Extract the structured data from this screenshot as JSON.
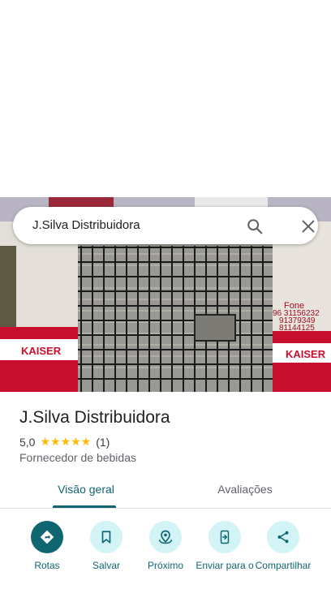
{
  "search": {
    "query": "J.Silva Distribuidora"
  },
  "photo": {
    "sign_left": "KAISER",
    "sign_right": "KAISER",
    "phone_heading": "Fone",
    "phone_lines": [
      "96 31156232",
      "91379349",
      "81144125"
    ]
  },
  "place": {
    "title": "J.Silva Distribuidora",
    "rating": "5,0",
    "stars": "★★★★★",
    "review_count": "(1)",
    "category": "Fornecedor de bebidas"
  },
  "tabs": [
    {
      "label": "Visão geral",
      "active": true
    },
    {
      "label": "Avaliações",
      "active": false
    }
  ],
  "actions": [
    {
      "label": "Rotas",
      "icon": "directions-icon"
    },
    {
      "label": "Salvar",
      "icon": "bookmark-icon"
    },
    {
      "label": "Próximo",
      "icon": "nearby-icon"
    },
    {
      "label": "Enviar para o",
      "icon": "send-to-phone-icon"
    },
    {
      "label": "Compartilhar",
      "icon": "share-icon"
    }
  ],
  "colors": {
    "accent": "#0f6670",
    "accent_light": "#d2f4f6",
    "star": "#fbbc04",
    "sign_red": "#c8102e"
  }
}
